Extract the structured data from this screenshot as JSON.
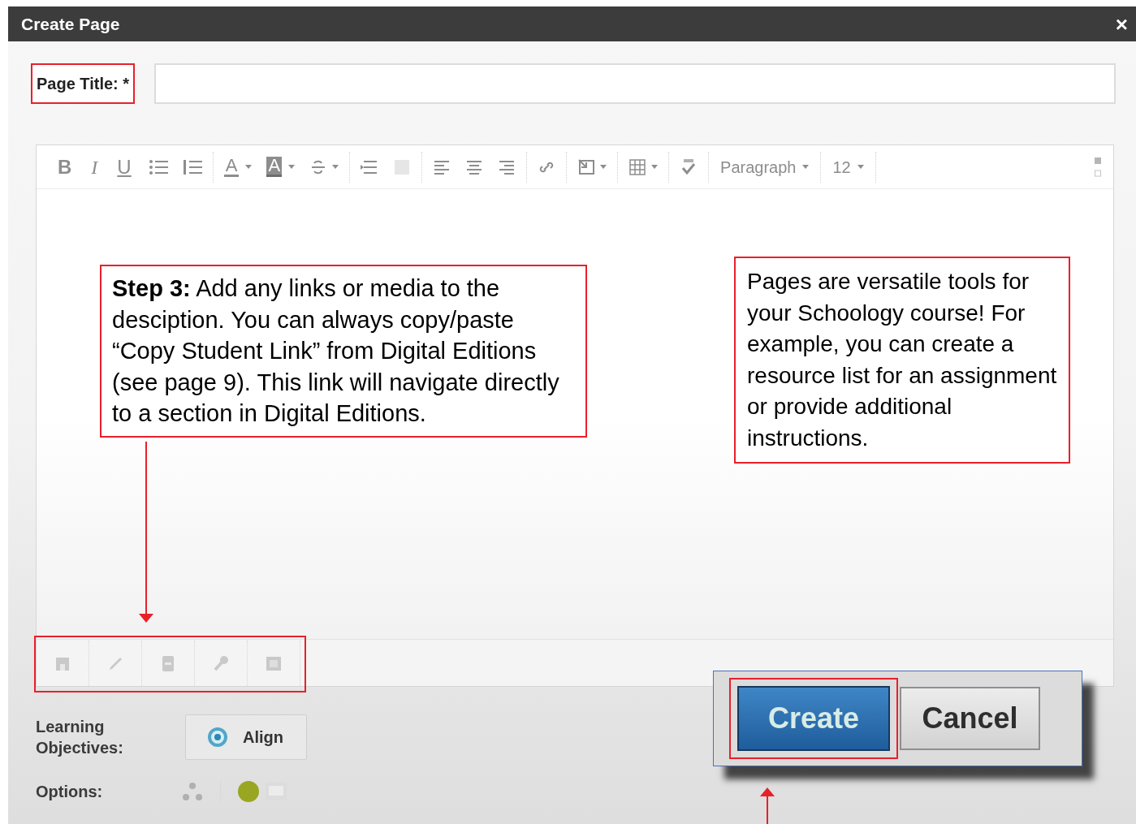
{
  "dialog": {
    "title": "Create Page",
    "close": "×"
  },
  "page_title": {
    "label": "Page Title: *"
  },
  "editor": {
    "format_buttons": [
      "B",
      "I",
      "U"
    ],
    "font_color": "A",
    "highlight_color": "A",
    "paragraph_select": "Paragraph",
    "size_select": "12"
  },
  "learning_objectives": {
    "label": "Learning Objectives:",
    "button": "Align"
  },
  "options": {
    "label": "Options:"
  },
  "buttons": [
    {
      "kind": "primary",
      "label": "Create"
    },
    {
      "kind": "secondary",
      "label": "Cancel"
    }
  ],
  "callouts": [
    {
      "kind": "step",
      "text": "**Step 3:** Add any links or media to the desciption. You can always copy/paste “Copy Student Link” from Digital Editions (see page 9). This link will navigate directly to a section in Digital Editions."
    },
    {
      "kind": "note",
      "text": "Pages are versatile tools for your Schoology course! For example, you can create a resource list for an assignment or provide additional instructions."
    }
  ]
}
